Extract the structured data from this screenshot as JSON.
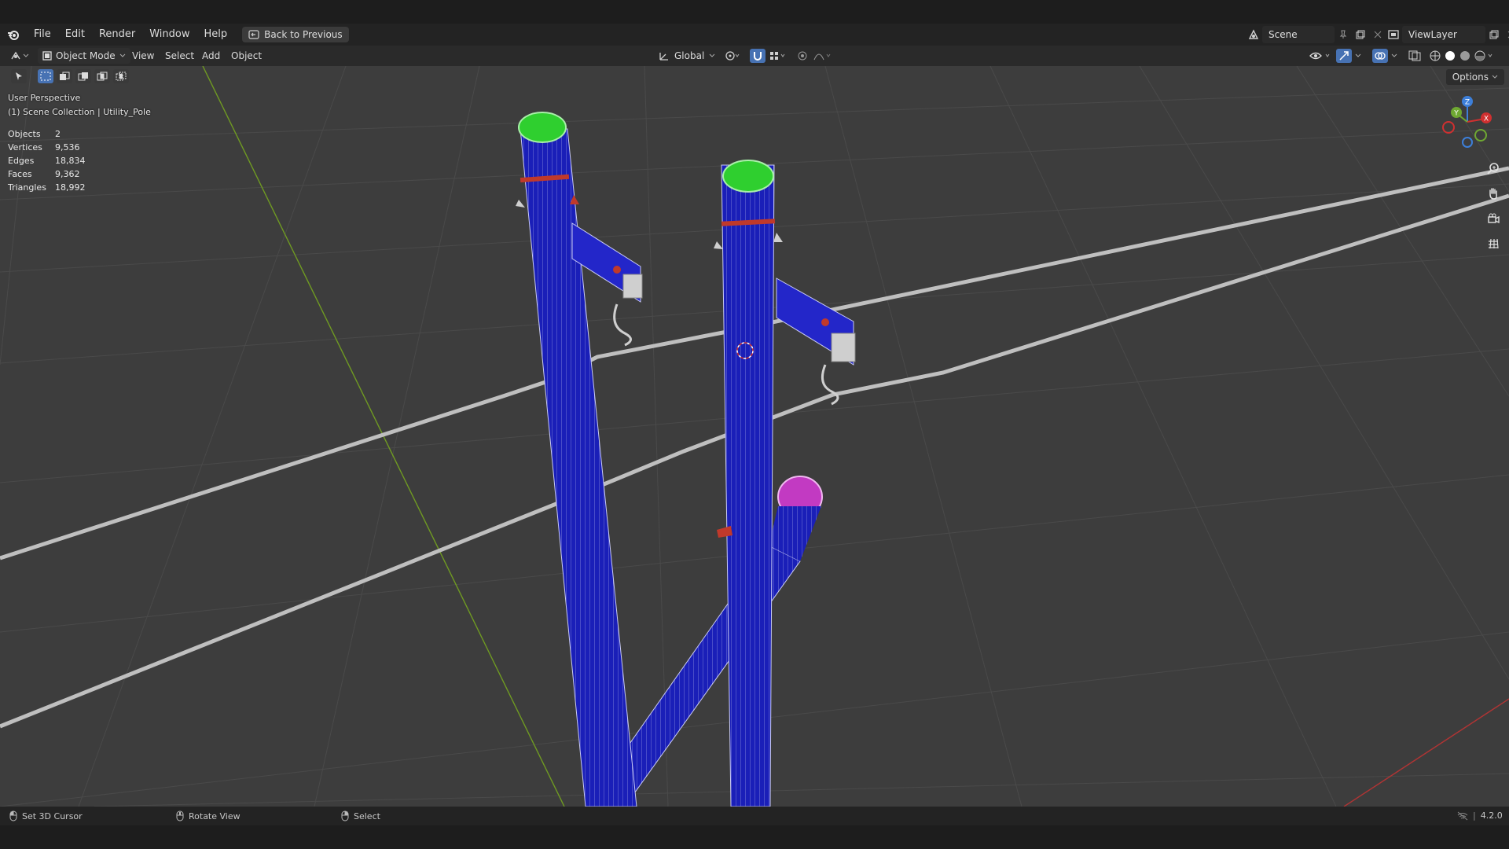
{
  "menubar": {
    "items": [
      "File",
      "Edit",
      "Render",
      "Window",
      "Help"
    ],
    "back_button": "Back to Previous",
    "scene_name": "Scene",
    "view_layer": "ViewLayer"
  },
  "toolbar": {
    "mode": "Object Mode",
    "menus": [
      "View",
      "Select",
      "Add",
      "Object"
    ],
    "transform_orientation": "Global",
    "options_label": "Options"
  },
  "viewport": {
    "perspective": "User Perspective",
    "collection": "(1) Scene Collection | Utility_Pole",
    "stats": [
      {
        "label": "Objects",
        "value": "2"
      },
      {
        "label": "Vertices",
        "value": "9,536"
      },
      {
        "label": "Edges",
        "value": "18,834"
      },
      {
        "label": "Faces",
        "value": "9,362"
      },
      {
        "label": "Triangles",
        "value": "18,992"
      }
    ],
    "gizmo_axes": [
      "X",
      "Y",
      "Z"
    ]
  },
  "statusbar": {
    "left_action": "Set 3D Cursor",
    "middle_action": "Rotate View",
    "right_action": "Select",
    "version": "4.2.0"
  },
  "colors": {
    "pole_blue": "#1a1fb8",
    "cap_green": "#2fcf2f",
    "cap_magenta": "#c23ac2",
    "grid_bg": "#3d3d3d",
    "y_axis": "#7fb02a",
    "x_axis": "#c83a3a"
  }
}
